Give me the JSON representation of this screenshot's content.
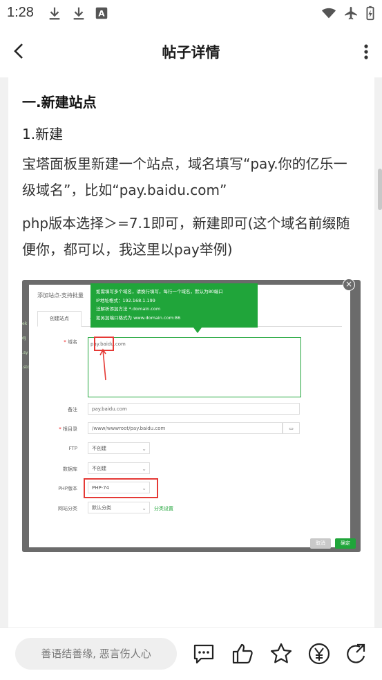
{
  "status_bar": {
    "time": "1:28"
  },
  "nav": {
    "title": "帖子详情"
  },
  "article": {
    "heading": "一.新建站点",
    "subheading": "1.新建",
    "para1": "宝塔面板里新建一个站点，域名填写“pay.你的亿乐一级域名”，比如“pay.baidu.com”",
    "para2": "php版本选择＞=7.1即可，新建即可(这个域名前缀随便你，都可以，我这里以pay举例)"
  },
  "embedded": {
    "dialog_title": "添加站点-支持批量",
    "tab_create": "创建站点",
    "tab_other": "一",
    "tooltip_lines": [
      "如需填写多个域名，请换行填写，每行一个域名，默认为80端口",
      "IP地址格式：192.168.1.199",
      "泛解析添加方法 *.domain.com",
      "如另加端口格式为 www.domain.com:86"
    ],
    "label_domain": "域名",
    "domain_value": "pay.baidu.com",
    "label_remark": "备注",
    "remark_value": "pay.baidu.com",
    "label_root": "根目录",
    "root_value": "/www/wwwroot/pay.baidu.com",
    "label_ftp": "FTP",
    "ftp_value": "不创建",
    "label_db": "数据库",
    "db_value": "不创建",
    "label_php": "PHP版本",
    "php_value": "PHP-74",
    "label_category": "网站分类",
    "category_value": "默认分类",
    "category_link": "分类设置",
    "btn_cancel": "取消",
    "btn_ok": "确定"
  },
  "bottom_bar": {
    "comment_placeholder": "善语结善缘, 恶言伤人心"
  },
  "colors": {
    "accent_green": "#20a53a",
    "highlight_red": "#e53935"
  }
}
